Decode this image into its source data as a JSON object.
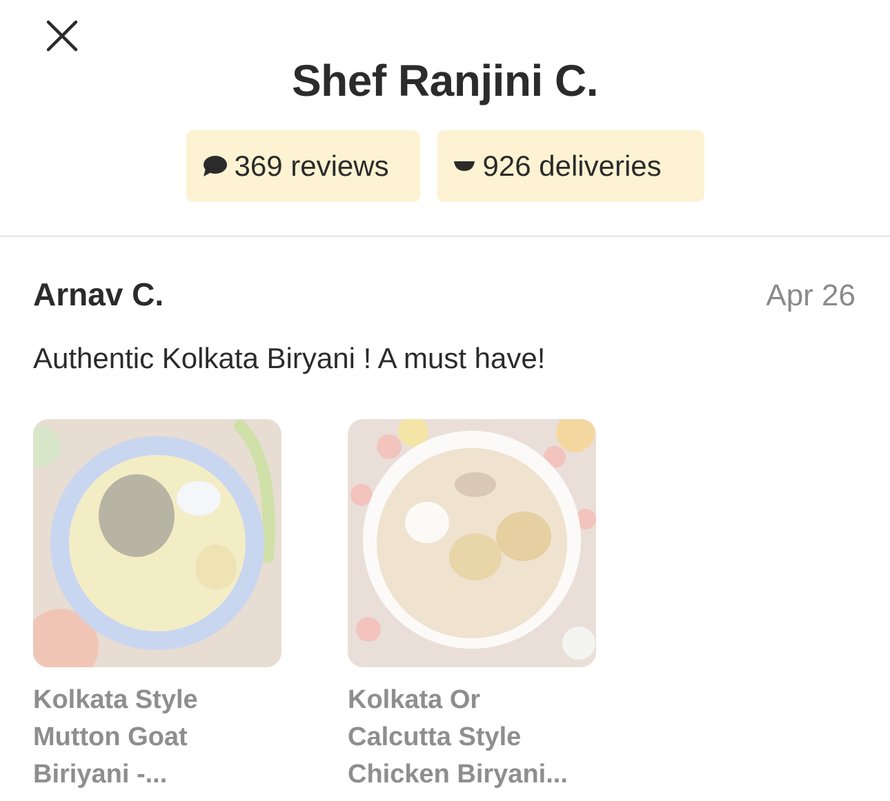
{
  "header": {
    "close_icon": "close-icon",
    "chef_name": "Shef Ranjini C."
  },
  "stats": {
    "reviews": {
      "icon": "speech-bubble-icon",
      "label": "369 reviews"
    },
    "deliveries": {
      "icon": "bowl-icon",
      "label": "926 deliveries"
    }
  },
  "review": {
    "reviewer": "Arnav C.",
    "date": "Apr 26",
    "text": "Authentic Kolkata Biryani ! A must have!"
  },
  "dishes": [
    {
      "name_line1": "Kolkata Style",
      "name_line2": "Mutton Goat",
      "name_line3": "Biriyani -..."
    },
    {
      "name_line1": "Kolkata Or",
      "name_line2": "Calcutta Style",
      "name_line3": "Chicken Biryani..."
    }
  ],
  "colors": {
    "chip_bg": "#fdf3d3",
    "text": "#2b2b2b",
    "muted": "#8a8a8a"
  }
}
